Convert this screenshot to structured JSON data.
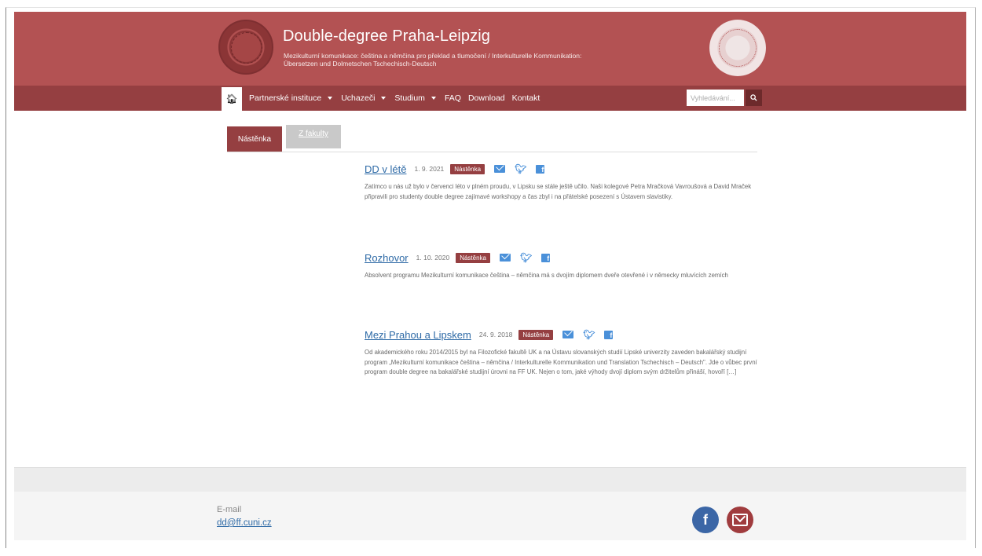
{
  "header": {
    "title": "Double-degree Praha-Leipzig",
    "subtitle": "Mezikulturní komunikace: čeština a němčina pro překlad a tlumočení / Interkulturelle Kommunikation: Übersetzen und Dolmetschen Tschechisch-Deutsch"
  },
  "nav": {
    "home_icon": "home-icon",
    "items": [
      {
        "label": "Partnerské instituce",
        "dropdown": true
      },
      {
        "label": "Uchazeči",
        "dropdown": true
      },
      {
        "label": "Studium",
        "dropdown": true
      },
      {
        "label": "FAQ",
        "dropdown": false
      },
      {
        "label": "Download",
        "dropdown": false
      },
      {
        "label": "Kontakt",
        "dropdown": false
      }
    ],
    "search_placeholder": "Vyhledávání..."
  },
  "tabs": [
    {
      "label": "Nástěnka",
      "active": true
    },
    {
      "label": "Z fakulty",
      "active": false
    }
  ],
  "posts": [
    {
      "title": "DD v létě",
      "date": "1. 9. 2021",
      "badge": "Nástěnka",
      "excerpt": "Zatímco u nás už bylo v červenci léto v plném proudu, v Lipsku se stále ještě učilo. Naši kolegové Petra Mračková Vavroušová a David Mraček připravili pro studenty double degree zajímavé workshopy a čas zbyl i na přátelské posezení s Ústavem slavistiky."
    },
    {
      "title": "Rozhovor",
      "date": "1. 10. 2020",
      "badge": "Nástěnka",
      "excerpt": "Absolvent programu Mezikulturní komunikace čeština – němčina má s dvojím diplomem dveře otevřené i v německy mluvících zemích"
    },
    {
      "title": "Mezi Prahou a Lipskem",
      "date": "24. 9. 2018",
      "badge": "Nástěnka",
      "excerpt": "Od akademického roku 2014/2015 byl na Filozofické fakultě UK a na Ústavu slovanských studií Lipské univerzity zaveden bakalářský studijní program „Mezikulturní komunikace čeština – němčina / Interkulturelle Kommunikation und Translation Tschechisch – Deutsch\". Jde o vůbec první program double degree na bakalářské studijní úrovni na FF UK. Nejen o tom, jaké výhody dvojí diplom svým držitelům přináší, hovoří […]"
    }
  ],
  "footer": {
    "email_label": "E-mail",
    "email": "dd@ff.cuni.cz",
    "facebook_glyph": "f"
  },
  "colors": {
    "header_bg": "#b35253",
    "nav_bg": "#953f41",
    "badge_bg": "#953f41",
    "link": "#2e6aa6"
  }
}
